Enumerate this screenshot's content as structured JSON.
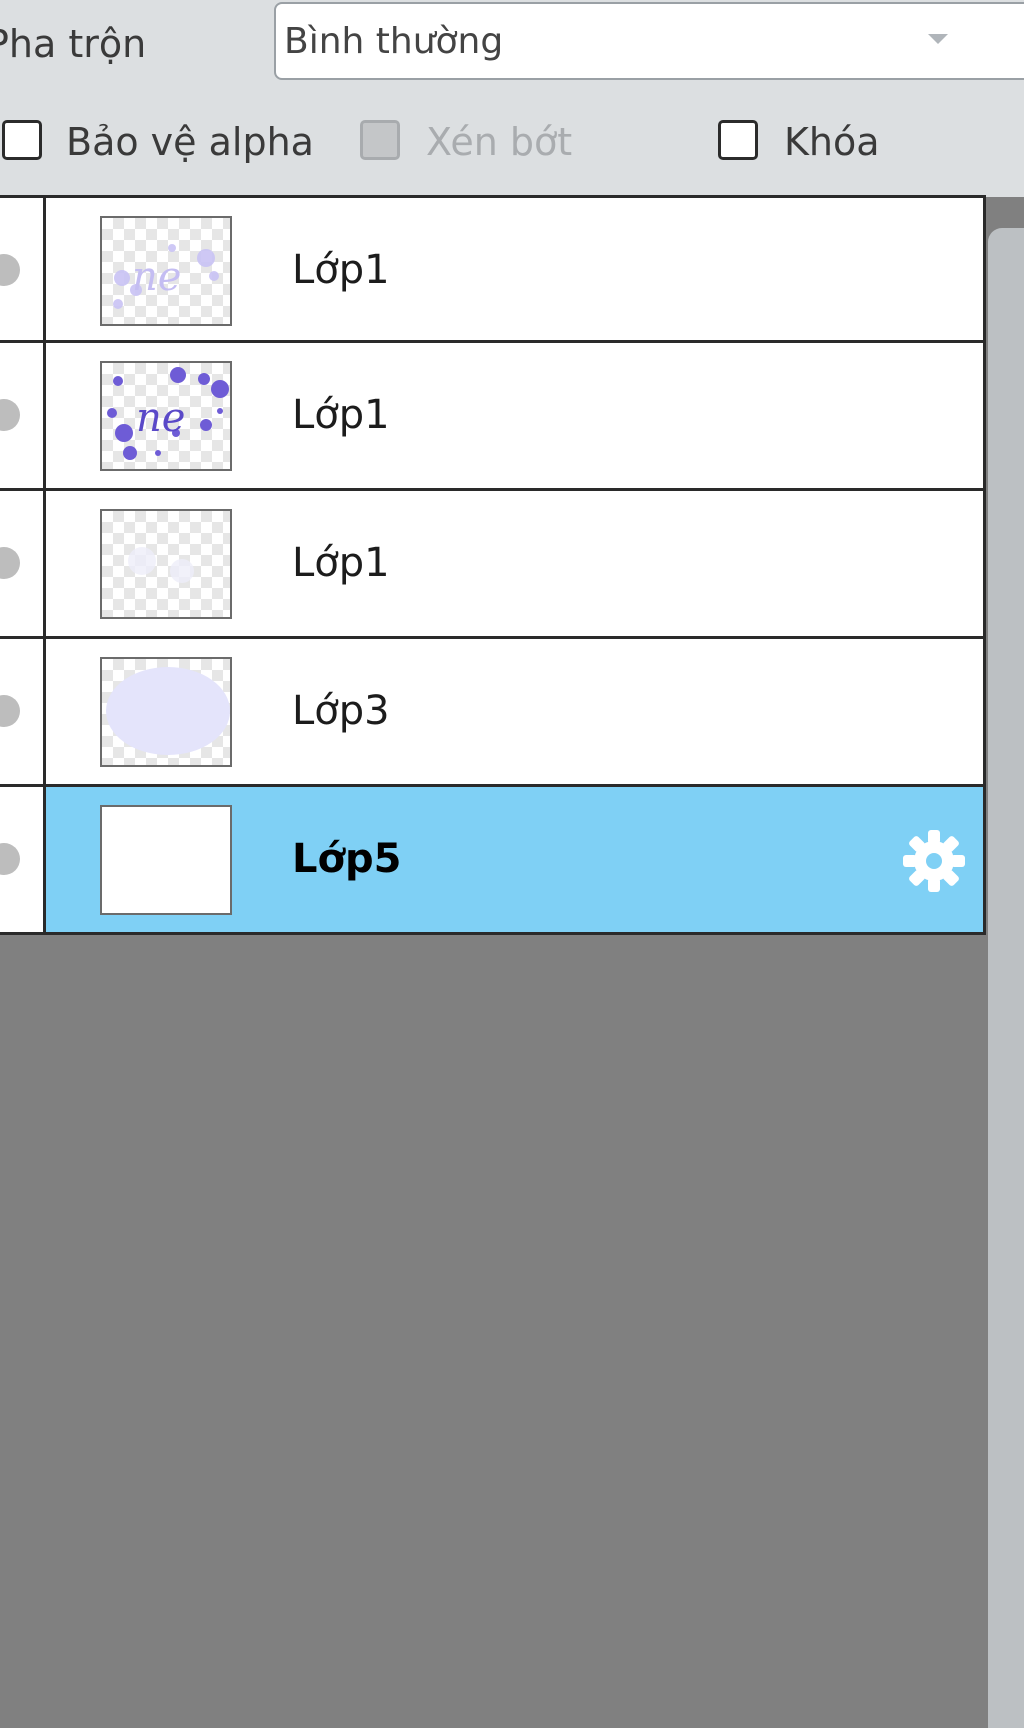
{
  "blend": {
    "label": "Pha trộn",
    "value": "Bình thường"
  },
  "options": {
    "protect_alpha": {
      "label": "Bảo vệ alpha",
      "checked": false,
      "enabled": true
    },
    "clipping": {
      "label": "Xén bớt",
      "checked": false,
      "enabled": false
    },
    "lock": {
      "label": "Khóa",
      "checked": false,
      "enabled": true
    }
  },
  "layers": [
    {
      "name": "Lớp1",
      "selected": false,
      "thumbnail": "light-purple-text"
    },
    {
      "name": "Lớp1",
      "selected": false,
      "thumbnail": "purple-dots-text"
    },
    {
      "name": "Lớp1",
      "selected": false,
      "thumbnail": "faint-transparent"
    },
    {
      "name": "Lớp3",
      "selected": false,
      "thumbnail": "lavender-fill"
    },
    {
      "name": "Lớp5",
      "selected": true,
      "thumbnail": "white"
    }
  ],
  "icons": {
    "layer_settings": "gear-icon",
    "visibility": "eye-dot-icon"
  },
  "colors": {
    "selected_row": "#7fd0f5",
    "empty_area": "#808080",
    "panel_bg": "#dcdfe1"
  }
}
